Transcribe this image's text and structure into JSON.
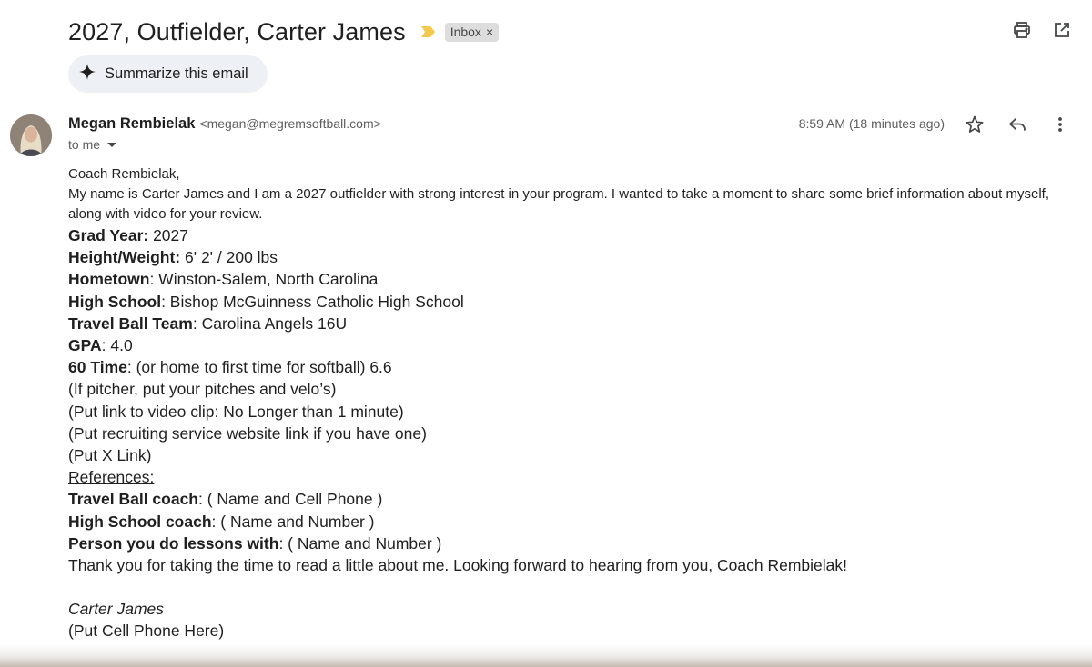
{
  "email": {
    "subject": "2027, Outfielder, Carter James",
    "label": "Inbox",
    "label_close": "×",
    "summarize_label": "Summarize this email",
    "sender_name": "Megan Rembielak",
    "sender_email": "<megan@megremsoftball.com>",
    "to": "to me",
    "timestamp": "8:59 AM (18 minutes ago)",
    "icons": {
      "print": "print-icon",
      "open_new_window": "open-in-new-window-icon",
      "summarize": "sparkle-icon",
      "star": "star-icon",
      "reply": "reply-icon",
      "more": "more-vertical-icon",
      "importance": "importance-marker-icon"
    },
    "colors": {
      "importance": "#f2c94c",
      "chip_bg": "#dddddd",
      "summarize_bg": "#edf0f5"
    }
  },
  "body": {
    "greeting": "Coach Rembielak,",
    "intro": "My name is Carter James and I am a 2027 outfielder with strong interest in your program. I wanted to take a moment to share some brief information about myself, along with video for your review.",
    "fields": {
      "grad_year": {
        "label": "Grad Year:",
        "value": " 2027"
      },
      "height_weight": {
        "label": "Height/Weight:",
        "value": " 6' 2' / 200 lbs"
      },
      "hometown": {
        "label": "Hometown",
        "value": ": Winston-Salem, North Carolina"
      },
      "high_school": {
        "label": "High School",
        "value": ": Bishop McGuinness Catholic High School"
      },
      "travel_team": {
        "label": "Travel Ball Team",
        "value": ": Carolina Angels 16U"
      },
      "gpa": {
        "label": "GPA",
        "value": ": 4.0"
      },
      "sixty_time": {
        "label": "60 Time",
        "value": ": (or home to first time for softball) 6.6"
      }
    },
    "pitcher_line": "(If pitcher, put your pitches and velo’s)",
    "video_line": "(Put link to video clip: No Longer than 1 minute)",
    "recruiting_line": "(Put recruiting service website link if you have one)",
    "x_link_line": "(Put X Link)",
    "references_heading": "References:",
    "references": {
      "travel_coach": {
        "label": "Travel Ball coach",
        "value": ": ( Name and Cell Phone )"
      },
      "hs_coach": {
        "label": "High School coach",
        "value": ": ( Name and Number )"
      },
      "lessons": {
        "label": "Person you do lessons with",
        "value": ": ( Name and Number )"
      }
    },
    "closing": "Thank you for taking the time to read a little about me. Looking forward to hearing from you, Coach Rembielak!",
    "signature_name": "Carter James",
    "signature_phone": "(Put Cell Phone Here)"
  }
}
